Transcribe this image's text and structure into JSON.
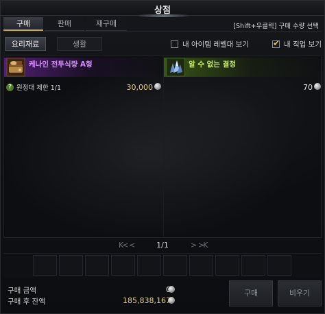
{
  "window": {
    "title": "상점"
  },
  "tabs": [
    {
      "label": "구매",
      "active": true
    },
    {
      "label": "판매",
      "active": false
    },
    {
      "label": "재구매",
      "active": false
    }
  ],
  "hint": "[Shift+우클릭] 구매 수량 선택",
  "subtabs": [
    {
      "label": "요리재료",
      "active": true
    },
    {
      "label": "생활",
      "active": false
    }
  ],
  "filters": {
    "item_level": {
      "label": "내 아이템 레벨대 보기",
      "checked": false
    },
    "my_class": {
      "label": "내 직업 보기",
      "checked": true
    }
  },
  "items": [
    {
      "name": "케나인 전투식량 A형",
      "price": "30,000",
      "limit": "원정대 제한 1/1",
      "limit_icon": "question-icon",
      "icon": "food-ration-icon",
      "grade_color": "#b455f0"
    },
    {
      "name": "알 수 없는 결정",
      "price": "70",
      "icon": "crystal-icon",
      "grade_color": "#7fb521"
    }
  ],
  "pager": {
    "current": "1/1",
    "first": "K<",
    "prev": "<",
    "next": ">",
    "last": ">K"
  },
  "footer": {
    "buy_amount_label": "구매 금액",
    "buy_amount": "0",
    "balance_label": "구매 후 잔액",
    "balance": "185,838,167"
  },
  "buttons": {
    "buy": "구매",
    "clear": "비우기"
  },
  "colors": {
    "accent_gold": "#c9a64a",
    "price_gold": "#e6d08a"
  }
}
